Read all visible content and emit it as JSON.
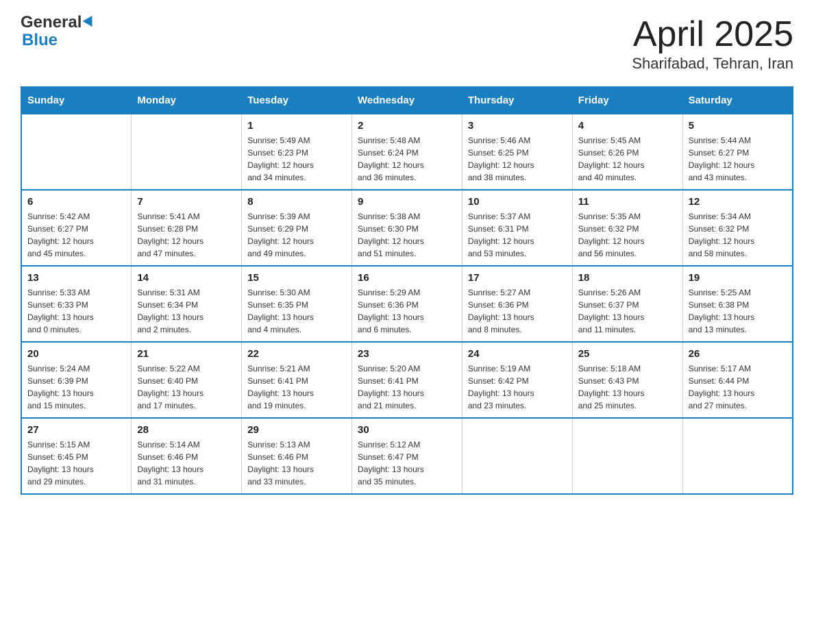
{
  "header": {
    "logo_line1": "General",
    "logo_line2": "Blue",
    "title": "April 2025",
    "subtitle": "Sharifabad, Tehran, Iran"
  },
  "columns": [
    "Sunday",
    "Monday",
    "Tuesday",
    "Wednesday",
    "Thursday",
    "Friday",
    "Saturday"
  ],
  "weeks": [
    [
      {
        "day": "",
        "info": ""
      },
      {
        "day": "",
        "info": ""
      },
      {
        "day": "1",
        "info": "Sunrise: 5:49 AM\nSunset: 6:23 PM\nDaylight: 12 hours\nand 34 minutes."
      },
      {
        "day": "2",
        "info": "Sunrise: 5:48 AM\nSunset: 6:24 PM\nDaylight: 12 hours\nand 36 minutes."
      },
      {
        "day": "3",
        "info": "Sunrise: 5:46 AM\nSunset: 6:25 PM\nDaylight: 12 hours\nand 38 minutes."
      },
      {
        "day": "4",
        "info": "Sunrise: 5:45 AM\nSunset: 6:26 PM\nDaylight: 12 hours\nand 40 minutes."
      },
      {
        "day": "5",
        "info": "Sunrise: 5:44 AM\nSunset: 6:27 PM\nDaylight: 12 hours\nand 43 minutes."
      }
    ],
    [
      {
        "day": "6",
        "info": "Sunrise: 5:42 AM\nSunset: 6:27 PM\nDaylight: 12 hours\nand 45 minutes."
      },
      {
        "day": "7",
        "info": "Sunrise: 5:41 AM\nSunset: 6:28 PM\nDaylight: 12 hours\nand 47 minutes."
      },
      {
        "day": "8",
        "info": "Sunrise: 5:39 AM\nSunset: 6:29 PM\nDaylight: 12 hours\nand 49 minutes."
      },
      {
        "day": "9",
        "info": "Sunrise: 5:38 AM\nSunset: 6:30 PM\nDaylight: 12 hours\nand 51 minutes."
      },
      {
        "day": "10",
        "info": "Sunrise: 5:37 AM\nSunset: 6:31 PM\nDaylight: 12 hours\nand 53 minutes."
      },
      {
        "day": "11",
        "info": "Sunrise: 5:35 AM\nSunset: 6:32 PM\nDaylight: 12 hours\nand 56 minutes."
      },
      {
        "day": "12",
        "info": "Sunrise: 5:34 AM\nSunset: 6:32 PM\nDaylight: 12 hours\nand 58 minutes."
      }
    ],
    [
      {
        "day": "13",
        "info": "Sunrise: 5:33 AM\nSunset: 6:33 PM\nDaylight: 13 hours\nand 0 minutes."
      },
      {
        "day": "14",
        "info": "Sunrise: 5:31 AM\nSunset: 6:34 PM\nDaylight: 13 hours\nand 2 minutes."
      },
      {
        "day": "15",
        "info": "Sunrise: 5:30 AM\nSunset: 6:35 PM\nDaylight: 13 hours\nand 4 minutes."
      },
      {
        "day": "16",
        "info": "Sunrise: 5:29 AM\nSunset: 6:36 PM\nDaylight: 13 hours\nand 6 minutes."
      },
      {
        "day": "17",
        "info": "Sunrise: 5:27 AM\nSunset: 6:36 PM\nDaylight: 13 hours\nand 8 minutes."
      },
      {
        "day": "18",
        "info": "Sunrise: 5:26 AM\nSunset: 6:37 PM\nDaylight: 13 hours\nand 11 minutes."
      },
      {
        "day": "19",
        "info": "Sunrise: 5:25 AM\nSunset: 6:38 PM\nDaylight: 13 hours\nand 13 minutes."
      }
    ],
    [
      {
        "day": "20",
        "info": "Sunrise: 5:24 AM\nSunset: 6:39 PM\nDaylight: 13 hours\nand 15 minutes."
      },
      {
        "day": "21",
        "info": "Sunrise: 5:22 AM\nSunset: 6:40 PM\nDaylight: 13 hours\nand 17 minutes."
      },
      {
        "day": "22",
        "info": "Sunrise: 5:21 AM\nSunset: 6:41 PM\nDaylight: 13 hours\nand 19 minutes."
      },
      {
        "day": "23",
        "info": "Sunrise: 5:20 AM\nSunset: 6:41 PM\nDaylight: 13 hours\nand 21 minutes."
      },
      {
        "day": "24",
        "info": "Sunrise: 5:19 AM\nSunset: 6:42 PM\nDaylight: 13 hours\nand 23 minutes."
      },
      {
        "day": "25",
        "info": "Sunrise: 5:18 AM\nSunset: 6:43 PM\nDaylight: 13 hours\nand 25 minutes."
      },
      {
        "day": "26",
        "info": "Sunrise: 5:17 AM\nSunset: 6:44 PM\nDaylight: 13 hours\nand 27 minutes."
      }
    ],
    [
      {
        "day": "27",
        "info": "Sunrise: 5:15 AM\nSunset: 6:45 PM\nDaylight: 13 hours\nand 29 minutes."
      },
      {
        "day": "28",
        "info": "Sunrise: 5:14 AM\nSunset: 6:46 PM\nDaylight: 13 hours\nand 31 minutes."
      },
      {
        "day": "29",
        "info": "Sunrise: 5:13 AM\nSunset: 6:46 PM\nDaylight: 13 hours\nand 33 minutes."
      },
      {
        "day": "30",
        "info": "Sunrise: 5:12 AM\nSunset: 6:47 PM\nDaylight: 13 hours\nand 35 minutes."
      },
      {
        "day": "",
        "info": ""
      },
      {
        "day": "",
        "info": ""
      },
      {
        "day": "",
        "info": ""
      }
    ]
  ]
}
